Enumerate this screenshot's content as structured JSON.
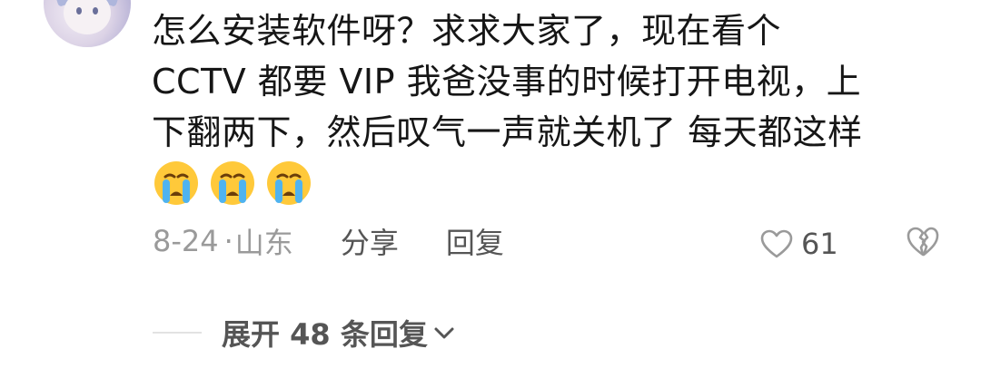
{
  "comment": {
    "text_lines": [
      "怎么安装软件呀？求求大家了，现在看个",
      "CCTV 都要 VIP  我爸没事的时候打开电视，上",
      "下翻两下，然后叹气一声就关机了  每天都这样"
    ],
    "emojis": [
      "crying-face-icon",
      "crying-face-icon",
      "crying-face-icon"
    ],
    "date": "8-24",
    "separator": "·",
    "location": "山东",
    "share_label": "分享",
    "reply_label": "回复",
    "like_count": "61",
    "expand_label": "展开 48 条回复"
  },
  "colors": {
    "text": "#161616",
    "meta": "#9a9a9a",
    "action": "#555555",
    "rule": "#e2e2e2"
  }
}
